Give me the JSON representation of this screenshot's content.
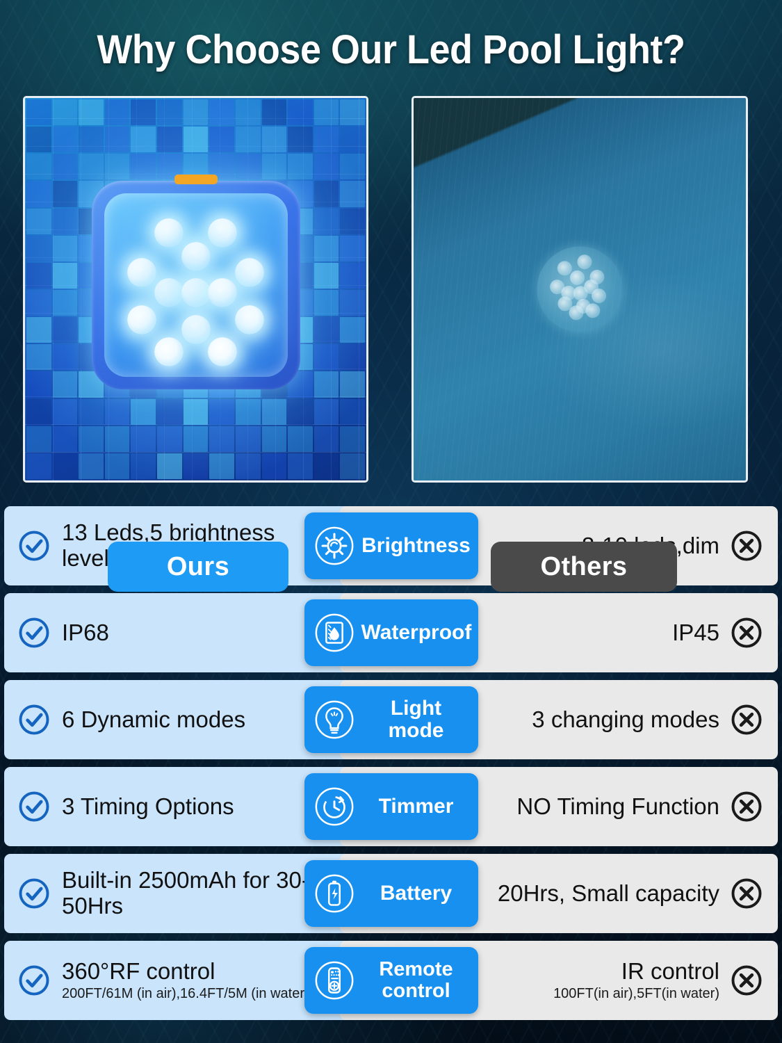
{
  "page": {
    "title": "Why Choose Our Led Pool Light?",
    "background": "#06192b"
  },
  "colors": {
    "accent_blue": "#1790f0",
    "tag_blue": "#1e9bf5",
    "tag_gray": "#4a4a4a",
    "panel_ours": "#c9e4fb",
    "panel_others": "#e9e9e9",
    "check": "#1565c0",
    "cross": "#1a1a1a"
  },
  "photos": {
    "ours": {
      "tag": "Ours",
      "caption_icon": "pool-light-on-mosaic-tile"
    },
    "others": {
      "tag": "Others",
      "caption_icon": "dim-round-light-in-pool"
    }
  },
  "comparison": {
    "check_icon": "check-circle-icon",
    "cross_icon": "x-circle-icon",
    "rows": [
      {
        "feature": "Brightness",
        "icon": "brightness-icon",
        "ours": "13 Leds,5 brightness levels",
        "ours_sub": "",
        "others": "8-10 leds,dim",
        "others_sub": ""
      },
      {
        "feature": "Waterproof",
        "icon": "waterdrop-icon",
        "ours": "IP68",
        "ours_sub": "",
        "others": "IP45",
        "others_sub": ""
      },
      {
        "feature": "Light mode",
        "icon": "lightbulb-icon",
        "ours": "6 Dynamic modes",
        "ours_sub": "",
        "others": "3 changing modes",
        "others_sub": ""
      },
      {
        "feature": "Timmer",
        "icon": "clock-icon",
        "ours": "3 Timing Options",
        "ours_sub": "",
        "others": "NO Timing Function",
        "others_sub": ""
      },
      {
        "feature": "Battery",
        "icon": "battery-icon",
        "ours": "Built-in 2500mAh for 30-50Hrs",
        "ours_sub": "",
        "others": "20Hrs, Small capacity",
        "others_sub": ""
      },
      {
        "feature": "Remote control",
        "icon": "remote-control-icon",
        "ours": "360°RF control",
        "ours_sub": "200FT/61M (in air),16.4FT/5M (in water)",
        "others": "IR control",
        "others_sub": "100FT(in air),5FT(in water)"
      }
    ]
  }
}
